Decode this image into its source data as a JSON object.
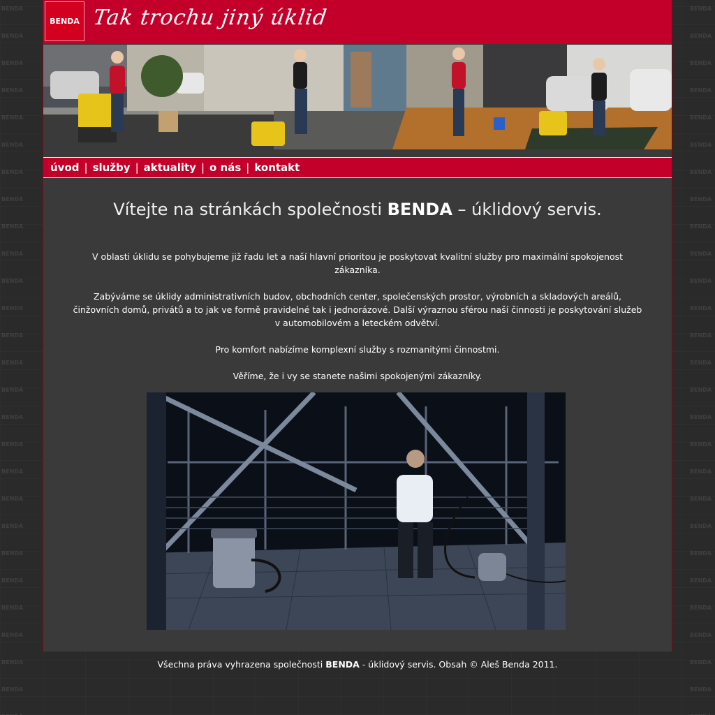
{
  "brand": {
    "logo_text": "BENDA",
    "slogan": "Tak trochu jiný úklid",
    "watermark": "BENDA",
    "accent_color": "#c3002a"
  },
  "nav": {
    "items": [
      {
        "label": "úvod"
      },
      {
        "label": "služby"
      },
      {
        "label": "aktuality"
      },
      {
        "label": "o nás"
      },
      {
        "label": "kontakt"
      }
    ],
    "separator": "|"
  },
  "main": {
    "headline_prefix": "Vítejte na stránkách společnosti ",
    "headline_brand": "BENDA",
    "headline_suffix": " – úklidový servis.",
    "paragraphs": [
      "V oblasti úklidu se pohybujeme již řadu let a naší hlavní prioritou je poskytovat kvalitní služby pro maximální spokojenost zákazníka.",
      "Zabýváme se úklidy administrativních budov, obchodních center, společenských prostor, výrobních a skladových areálů, činžovních domů, privátů a to jak ve formě pravidelné tak i jednorázové. Další výraznou sférou naší činnosti je poskytování služeb v automobilovém a leteckém odvětví.",
      "Pro komfort nabízíme komplexní služby s rozmanitými činnostmi.",
      "Věříme, že i vy se stanete našimi spokojenými zákazníky."
    ]
  },
  "footer": {
    "prefix": "Všechna práva vyhrazena společnosti ",
    "brand": "BENDA",
    "suffix": " - úklidový servis. Obsah © Aleš Benda 2011."
  }
}
